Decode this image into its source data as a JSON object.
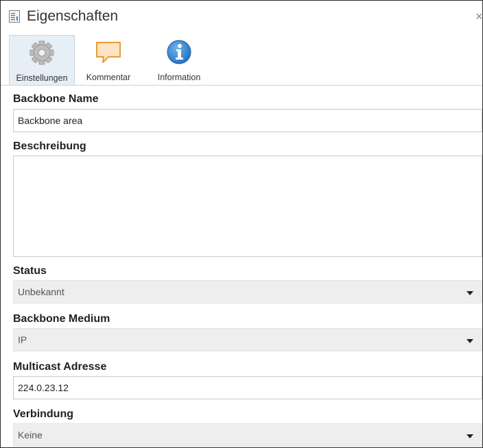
{
  "window": {
    "title": "Eigenschaften",
    "close_glyph": "×"
  },
  "tabs": [
    {
      "label": "Einstellungen",
      "icon": "gear-icon",
      "active": true
    },
    {
      "label": "Kommentar",
      "icon": "comment-icon",
      "active": false
    },
    {
      "label": "Information",
      "icon": "info-icon",
      "active": false
    }
  ],
  "form": {
    "backbone_name": {
      "label": "Backbone Name",
      "value": "Backbone area"
    },
    "description": {
      "label": "Beschreibung",
      "value": ""
    },
    "status": {
      "label": "Status",
      "value": "Unbekannt"
    },
    "medium": {
      "label": "Backbone Medium",
      "value": "IP"
    },
    "multicast": {
      "label": "Multicast Adresse",
      "value": "224.0.23.12"
    },
    "connection": {
      "label": "Verbindung",
      "value": "Keine"
    }
  },
  "colors": {
    "info_blue": "#1f78c8",
    "comment_orange": "#e89a3c",
    "comment_fill": "#fde4c2",
    "active_tab": "#e6eef6"
  }
}
